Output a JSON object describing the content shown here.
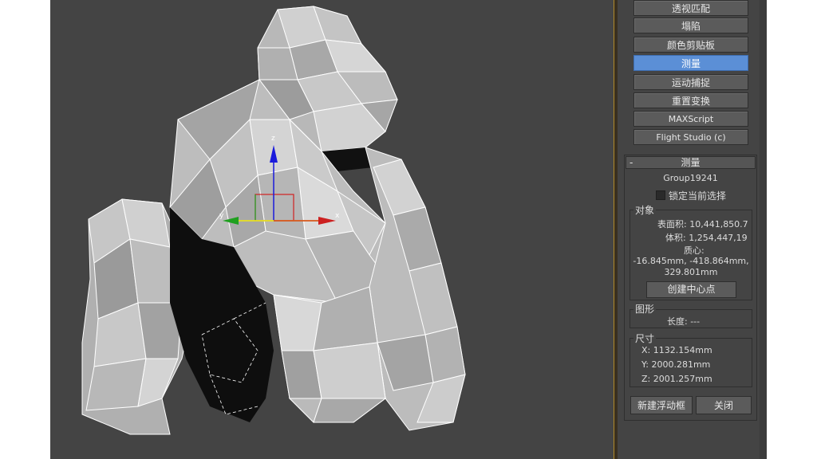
{
  "utility_buttons": [
    {
      "label": "透视匹配",
      "active": false
    },
    {
      "label": "塌陷",
      "active": false
    },
    {
      "label": "颜色剪贴板",
      "active": false
    },
    {
      "label": "测量",
      "active": true
    },
    {
      "label": "运动捕捉",
      "active": false
    },
    {
      "label": "重置变换",
      "active": false
    },
    {
      "label": "MAXScript",
      "active": false
    },
    {
      "label": "Flight Studio (c)",
      "active": false
    }
  ],
  "measure": {
    "toggle": "-",
    "title": "测量",
    "object_name": "Group19241",
    "lock_label": "锁定当前选择",
    "lock_checked": false,
    "object_group": {
      "title": "对象",
      "surface_area": "表面积: 10,441,850.7",
      "volume": "体积: 1,254,447,19",
      "center_label": "质心:",
      "center_line1": "-16.845mm, -418.864mm,",
      "center_line2": "329.801mm",
      "create_center_button": "创建中心点"
    },
    "shape_group": {
      "title": "图形",
      "length": "长度: ---"
    },
    "dimensions_group": {
      "title": "尺寸",
      "x": "X:  1132.154mm",
      "y": "Y:  2000.281mm",
      "z": "Z:  2001.257mm"
    },
    "new_floater_button": "新建浮动框",
    "close_button": "关闭"
  },
  "gizmo": {
    "x_label": "x",
    "y_label": "y",
    "z_label": "z"
  },
  "colors": {
    "viewport_bg": "#444444",
    "active_button": "#5b8fd6",
    "axis_x": "#cc2020",
    "axis_y": "#20a020",
    "axis_z": "#1a1adc",
    "gizmo_yellow": "#e8e020"
  }
}
